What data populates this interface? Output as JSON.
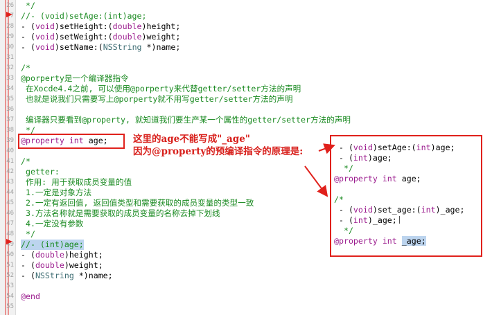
{
  "editor": {
    "lines": [
      {
        "n": "26",
        "segs": [
          {
            "t": " */",
            "c": "cm"
          }
        ]
      },
      {
        "n": "27",
        "segs": [
          {
            "t": "//- (void)setAge:(int)age;",
            "c": "cm"
          }
        ]
      },
      {
        "n": "28",
        "segs": [
          {
            "t": "- (",
            "c": ""
          },
          {
            "t": "void",
            "c": "kw"
          },
          {
            "t": ")setHeight:(",
            "c": ""
          },
          {
            "t": "double",
            "c": "kw"
          },
          {
            "t": ")height;",
            "c": ""
          }
        ]
      },
      {
        "n": "29",
        "segs": [
          {
            "t": "- (",
            "c": ""
          },
          {
            "t": "void",
            "c": "kw"
          },
          {
            "t": ")setWeight:(",
            "c": ""
          },
          {
            "t": "double",
            "c": "kw"
          },
          {
            "t": ")weight;",
            "c": ""
          }
        ]
      },
      {
        "n": "30",
        "segs": [
          {
            "t": "- (",
            "c": ""
          },
          {
            "t": "void",
            "c": "kw"
          },
          {
            "t": ")setName:(",
            "c": ""
          },
          {
            "t": "NSString",
            "c": "ty"
          },
          {
            "t": " *)name;",
            "c": ""
          }
        ]
      },
      {
        "n": "31",
        "segs": []
      },
      {
        "n": "32",
        "segs": [
          {
            "t": "/*",
            "c": "cm"
          }
        ]
      },
      {
        "n": "33",
        "segs": [
          {
            "t": "@porperty是一个编译器指令",
            "c": "cm"
          }
        ]
      },
      {
        "n": "34",
        "segs": [
          {
            "t": " 在Xocde4.4之前, 可以使用@porperty来代替getter/setter方法的声明",
            "c": "cm"
          }
        ]
      },
      {
        "n": "35",
        "segs": [
          {
            "t": " 也就是说我们只需要写上@porperty就不用写getter/setter方法的声明",
            "c": "cm"
          }
        ]
      },
      {
        "n": "36",
        "segs": []
      },
      {
        "n": "37",
        "segs": [
          {
            "t": " 编译器只要看到@property, 就知道我们要生产某一个属性的getter/setter方法的声明",
            "c": "cm"
          }
        ]
      },
      {
        "n": "38",
        "segs": [
          {
            "t": " */",
            "c": "cm"
          }
        ]
      },
      {
        "n": "39",
        "segs": [
          {
            "t": "@property",
            "c": "at"
          },
          {
            "t": " ",
            "c": ""
          },
          {
            "t": "int",
            "c": "kw"
          },
          {
            "t": " age;",
            "c": ""
          }
        ]
      },
      {
        "n": "40",
        "segs": []
      },
      {
        "n": "41",
        "segs": [
          {
            "t": "/*",
            "c": "cm"
          }
        ]
      },
      {
        "n": "42",
        "segs": [
          {
            "t": " getter:",
            "c": "cm"
          }
        ]
      },
      {
        "n": "43",
        "segs": [
          {
            "t": " 作用: 用于获取成员变量的值",
            "c": "cm"
          }
        ]
      },
      {
        "n": "44",
        "segs": [
          {
            "t": " 1.一定是对象方法",
            "c": "cm"
          }
        ]
      },
      {
        "n": "45",
        "segs": [
          {
            "t": " 2.一定有返回值, 返回值类型和需要获取的成员变量的类型一致",
            "c": "cm"
          }
        ]
      },
      {
        "n": "46",
        "segs": [
          {
            "t": " 3.方法名称就是需要获取的成员变量的名称去掉下划线",
            "c": "cm"
          }
        ]
      },
      {
        "n": "47",
        "segs": [
          {
            "t": " 4.一定没有参数",
            "c": "cm"
          }
        ]
      },
      {
        "n": "48",
        "segs": [
          {
            "t": " */",
            "c": "cm"
          }
        ]
      },
      {
        "n": "49",
        "segs": [
          {
            "t": "//- (int)age;",
            "c": "cm"
          }
        ],
        "highlight": true
      },
      {
        "n": "50",
        "segs": [
          {
            "t": "- (",
            "c": ""
          },
          {
            "t": "double",
            "c": "kw"
          },
          {
            "t": ")height;",
            "c": ""
          }
        ]
      },
      {
        "n": "51",
        "segs": [
          {
            "t": "- (",
            "c": ""
          },
          {
            "t": "double",
            "c": "kw"
          },
          {
            "t": ")weight;",
            "c": ""
          }
        ]
      },
      {
        "n": "52",
        "segs": [
          {
            "t": "- (",
            "c": ""
          },
          {
            "t": "NSString",
            "c": "ty"
          },
          {
            "t": " *)name;",
            "c": ""
          }
        ]
      },
      {
        "n": "53",
        "segs": []
      },
      {
        "n": "54",
        "segs": [
          {
            "t": "@end",
            "c": "at"
          }
        ]
      },
      {
        "n": "55",
        "segs": []
      }
    ]
  },
  "annotation": {
    "line1": "这里的age不能写成\"_age\"",
    "line2": "因为@property的预编译指令的原理是:"
  },
  "panel": {
    "lines": [
      {
        "segs": [
          {
            "t": " - (",
            "c": ""
          },
          {
            "t": "void",
            "c": "kw"
          },
          {
            "t": ")setAge:(",
            "c": ""
          },
          {
            "t": "int",
            "c": "kw"
          },
          {
            "t": ")age;",
            "c": ""
          }
        ]
      },
      {
        "segs": [
          {
            "t": " - (",
            "c": ""
          },
          {
            "t": "int",
            "c": "kw"
          },
          {
            "t": ")age;",
            "c": ""
          }
        ]
      },
      {
        "segs": [
          {
            "t": "  */",
            "c": "cm"
          }
        ]
      },
      {
        "segs": [
          {
            "t": "@property",
            "c": "at"
          },
          {
            "t": " ",
            "c": ""
          },
          {
            "t": "int",
            "c": "kw"
          },
          {
            "t": " age;",
            "c": ""
          }
        ]
      },
      {
        "segs": []
      },
      {
        "segs": [
          {
            "t": "/*",
            "c": "cm"
          }
        ]
      },
      {
        "segs": [
          {
            "t": " - (",
            "c": ""
          },
          {
            "t": "void",
            "c": "kw"
          },
          {
            "t": ")set_age:(",
            "c": ""
          },
          {
            "t": "int",
            "c": "kw"
          },
          {
            "t": ")_age;",
            "c": ""
          }
        ]
      },
      {
        "segs": [
          {
            "t": " - (",
            "c": ""
          },
          {
            "t": "int",
            "c": "kw"
          },
          {
            "t": ")_age;",
            "c": ""
          }
        ],
        "cursor": true
      },
      {
        "segs": [
          {
            "t": "  */",
            "c": "cm"
          }
        ]
      },
      {
        "segs": [
          {
            "t": "@property",
            "c": "at"
          },
          {
            "t": " ",
            "c": ""
          },
          {
            "t": "int",
            "c": "kw"
          },
          {
            "t": " ",
            "c": ""
          },
          {
            "t": "_age;",
            "c": "sel"
          }
        ]
      }
    ]
  },
  "colors": {
    "comment": "#1a8a21",
    "keyword": "#9b1c8e",
    "type": "#3f6e74",
    "annotation_red": "#e0211c",
    "highlight": "#bcd4ee"
  }
}
